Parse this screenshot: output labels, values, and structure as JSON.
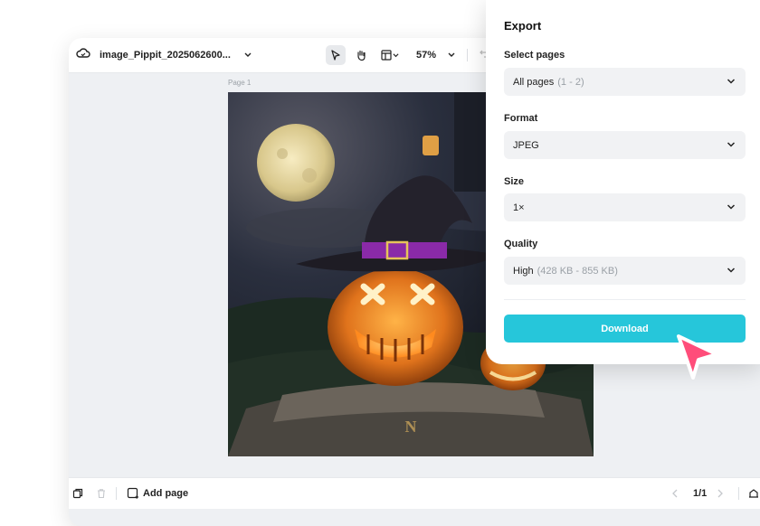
{
  "editor": {
    "filename": "image_Pippit_2025062600...",
    "zoom": "57%",
    "page_label": "Page 1",
    "add_page_label": "Add page",
    "page_count": "1/1"
  },
  "icons": {
    "cloud": "cloud-icon",
    "select_tool": "cursor-arrow-icon",
    "hand_tool": "hand-icon",
    "layout": "layout-icon",
    "undo": "undo-icon"
  },
  "export": {
    "title": "Export",
    "select_pages": {
      "label": "Select pages",
      "value": "All pages",
      "hint": "(1 - 2)"
    },
    "format": {
      "label": "Format",
      "value": "JPEG"
    },
    "size": {
      "label": "Size",
      "value": "1×"
    },
    "quality": {
      "label": "Quality",
      "value": "High",
      "hint": "(428 KB - 855 KB)"
    },
    "download_label": "Download"
  },
  "colors": {
    "accent": "#26c6da",
    "cursor": "#ff4d7a"
  }
}
